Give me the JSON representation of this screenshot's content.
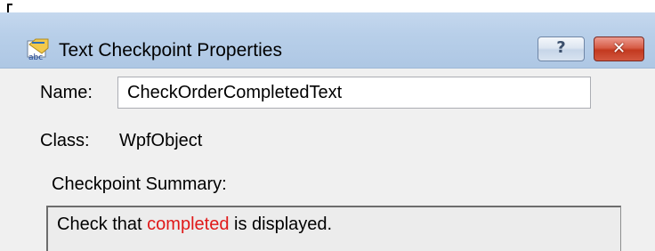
{
  "window": {
    "title": "Text Checkpoint Properties",
    "help_glyph": "?",
    "close_glyph": "✕",
    "icon": "abc-text-checkpoint-icon"
  },
  "form": {
    "name_label": "Name:",
    "name_value": "CheckOrderCompletedText",
    "class_label": "Class:",
    "class_value": "WpfObject",
    "summary_label": "Checkpoint Summary:",
    "summary": {
      "prefix": "Check that ",
      "highlight": "completed",
      "suffix": " is displayed."
    }
  },
  "colors": {
    "highlight": "#e01818",
    "titlebar": "#b8cfe9",
    "close_button": "#c3391f"
  }
}
